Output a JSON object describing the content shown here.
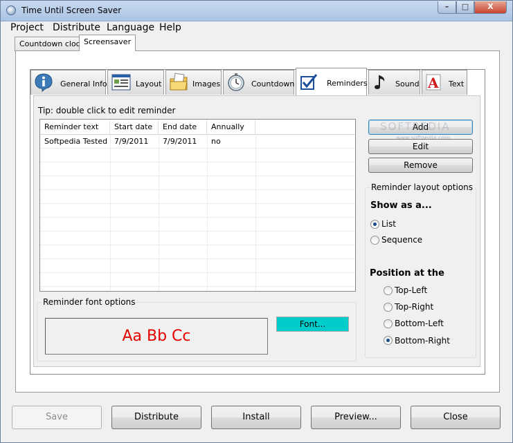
{
  "window": {
    "title": "Time Until Screen Saver",
    "controls": {
      "minimize": "–",
      "maximize": "□",
      "close": "X"
    }
  },
  "menu": [
    "Project",
    "Distribute",
    "Language",
    "Help"
  ],
  "outer_tabs": [
    {
      "label": "Countdown clock",
      "active": false
    },
    {
      "label": "Screensaver",
      "active": true
    }
  ],
  "inner_tabs": [
    {
      "label": "General Info",
      "icon": "info-icon"
    },
    {
      "label": "Layout",
      "icon": "layout-window-icon"
    },
    {
      "label": "Images",
      "icon": "images-folder-icon"
    },
    {
      "label": "Countdown",
      "icon": "stopwatch-icon"
    },
    {
      "label": "Reminders",
      "icon": "checkbox-pen-icon",
      "active": true
    },
    {
      "label": "Sound",
      "icon": "music-note-icon"
    },
    {
      "label": "Text",
      "icon": "text-a-icon"
    }
  ],
  "reminders": {
    "tip": "Tip: double click to edit reminder",
    "columns": [
      "Reminder text",
      "Start date",
      "End date",
      "Annually"
    ],
    "rows": [
      [
        "Softpedia Tested",
        "7/9/2011",
        "7/9/2011",
        "no"
      ]
    ],
    "buttons": {
      "add": "Add",
      "edit": "Edit",
      "remove": "Remove"
    },
    "watermark": {
      "main": "SOFTPEDIA",
      "sub": "www.softpedia.com"
    }
  },
  "layout_options": {
    "legend": "Reminder layout options",
    "show_as_label": "Show as a...",
    "show_as": [
      {
        "label": "List",
        "checked": true
      },
      {
        "label": "Sequence",
        "checked": false
      }
    ],
    "position_label": "Position at the",
    "positions": [
      {
        "label": "Top-Left",
        "checked": false
      },
      {
        "label": "Top-Right",
        "checked": false
      },
      {
        "label": "Bottom-Left",
        "checked": false
      },
      {
        "label": "Bottom-Right",
        "checked": true
      }
    ]
  },
  "font_options": {
    "legend": "Reminder font  options",
    "preview": "Aa Bb Cc",
    "font_button": "Font..."
  },
  "bottom_buttons": {
    "save": "Save",
    "distribute": "Distribute",
    "install": "Install",
    "preview": "Preview...",
    "close": "Close"
  }
}
